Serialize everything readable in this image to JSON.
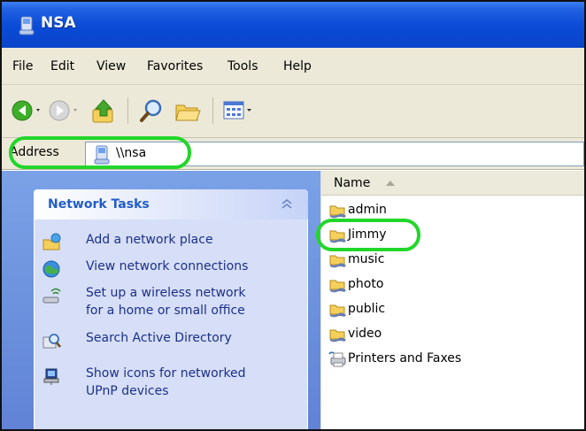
{
  "window": {
    "title": "NSA"
  },
  "menu": {
    "items": [
      "File",
      "Edit",
      "View",
      "Favorites",
      "Tools",
      "Help"
    ]
  },
  "toolbar": {
    "buttons": [
      "back-icon",
      "forward-icon",
      "up-folder-icon",
      "search-icon",
      "folders-icon",
      "views-icon"
    ]
  },
  "address": {
    "label": "Address",
    "value": "\\\\nsa"
  },
  "network_tasks": {
    "title": "Network Tasks",
    "tasks": [
      {
        "label_lines": [
          "Add a network place"
        ],
        "icon": "add-network-place-icon"
      },
      {
        "label_lines": [
          "View network connections"
        ],
        "icon": "network-connections-icon"
      },
      {
        "label_lines": [
          "Set up a wireless network",
          "for a home or small office"
        ],
        "icon": "wireless-network-icon"
      },
      {
        "label_lines": [
          "Search Active Directory"
        ],
        "icon": "search-directory-icon"
      },
      {
        "label_lines": [
          "Show icons for networked",
          "UPnP devices"
        ],
        "icon": "upnp-devices-icon"
      }
    ]
  },
  "file_list": {
    "column": "Name",
    "items": [
      {
        "name": "admin",
        "type": "share"
      },
      {
        "name": "Jimmy",
        "type": "share"
      },
      {
        "name": "music",
        "type": "share"
      },
      {
        "name": "photo",
        "type": "share"
      },
      {
        "name": "public",
        "type": "share"
      },
      {
        "name": "video",
        "type": "share"
      },
      {
        "name": "Printers and Faxes",
        "type": "printers"
      }
    ]
  },
  "colors": {
    "highlight": "#22d62a",
    "titlebar": "#0a4ad6",
    "task_text": "#1c2f8a"
  }
}
